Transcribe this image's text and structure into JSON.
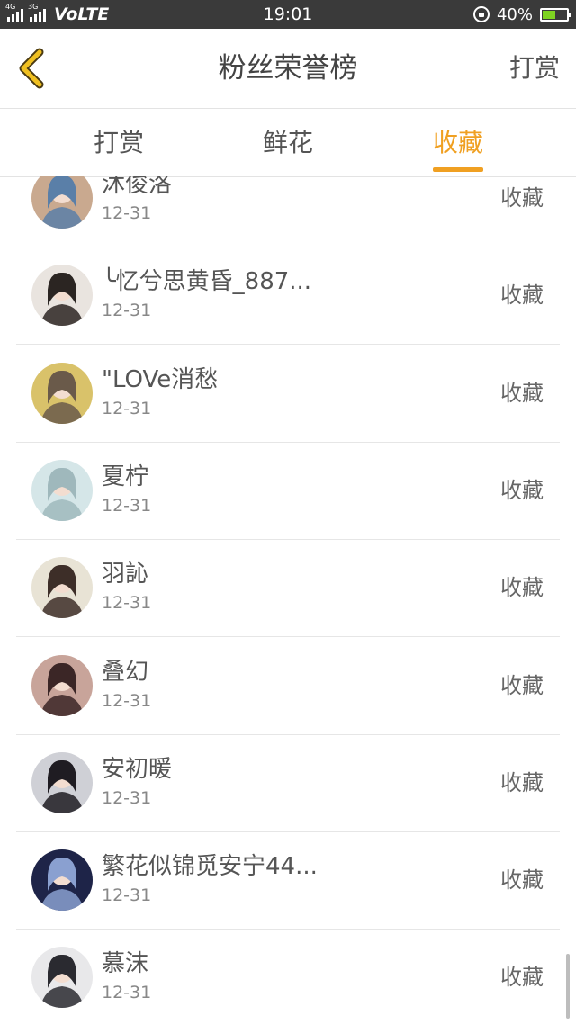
{
  "status_bar": {
    "network_1": "4G",
    "network_2": "3G",
    "volte": "VoLTE",
    "time": "19:01",
    "battery": "40%"
  },
  "header": {
    "title": "粉丝荣誉榜",
    "action": "打赏"
  },
  "tabs": [
    {
      "label": "打赏",
      "active": false
    },
    {
      "label": "鲜花",
      "active": false
    },
    {
      "label": "收藏",
      "active": true
    }
  ],
  "list": [
    {
      "name": "沐俊洛",
      "date": "12-31",
      "action": "收藏",
      "avatar_colors": [
        "#c9a98f",
        "#5a7fa8"
      ]
    },
    {
      "name": "╰忆兮思黄昏_887...",
      "date": "12-31",
      "action": "收藏",
      "avatar_colors": [
        "#e9e4df",
        "#2b2522"
      ]
    },
    {
      "name": "\"LOVe消愁",
      "date": "12-31",
      "action": "收藏",
      "avatar_colors": [
        "#d9c26a",
        "#6a5a4a"
      ]
    },
    {
      "name": "夏柠",
      "date": "12-31",
      "action": "收藏",
      "avatar_colors": [
        "#d5e6e8",
        "#9fb8bc"
      ]
    },
    {
      "name": "羽訫",
      "date": "12-31",
      "action": "收藏",
      "avatar_colors": [
        "#e8e3d5",
        "#3d2e28"
      ]
    },
    {
      "name": "叠幻",
      "date": "12-31",
      "action": "收藏",
      "avatar_colors": [
        "#c8a49a",
        "#3b2626"
      ]
    },
    {
      "name": "安初暖",
      "date": "12-31",
      "action": "收藏",
      "avatar_colors": [
        "#cfd0d6",
        "#1f1c22"
      ]
    },
    {
      "name": "繁花似锦觅安宁44...",
      "date": "12-31",
      "action": "收藏",
      "avatar_colors": [
        "#1e2448",
        "#8aa0d0"
      ]
    },
    {
      "name": "慕沫",
      "date": "12-31",
      "action": "收藏",
      "avatar_colors": [
        "#e8e8ea",
        "#2a2a30"
      ]
    }
  ],
  "colors": {
    "accent": "#f0a022",
    "status_bar_bg": "#3a3a3a",
    "battery_fill": "#7ed321"
  },
  "icons": {
    "back": "back-chevron-icon",
    "lock": "rotation-lock-icon",
    "battery": "battery-icon"
  }
}
